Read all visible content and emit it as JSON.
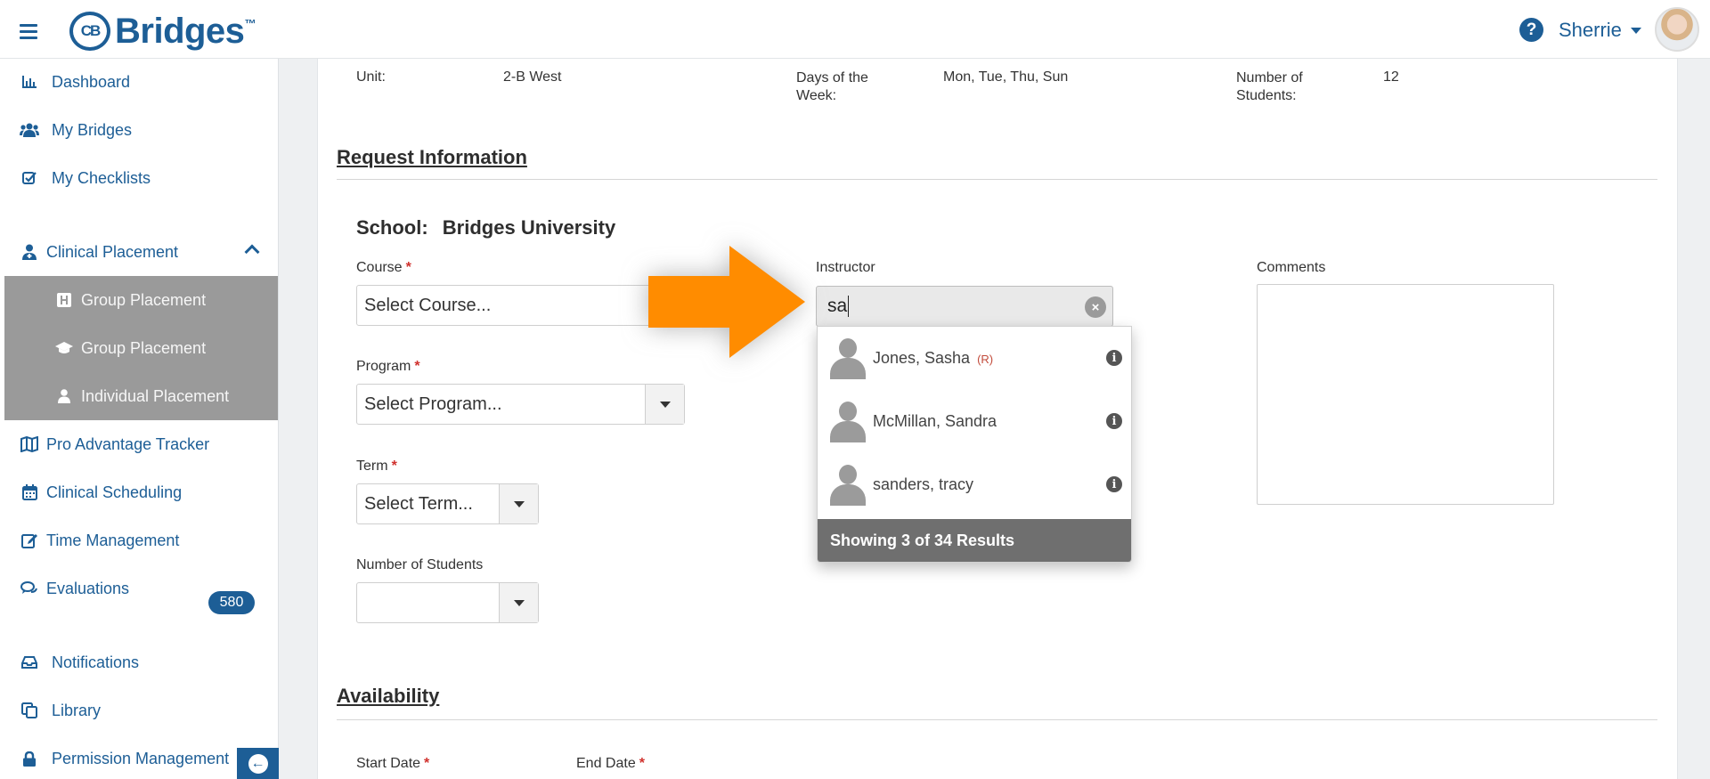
{
  "header": {
    "logo_text": "Bridges",
    "logo_badge": "CB",
    "logo_tm": "™",
    "user_name": "Sherrie"
  },
  "sidebar": {
    "items": [
      {
        "label": "Dashboard",
        "icon": "bar-chart-icon"
      },
      {
        "label": "My Bridges",
        "icon": "users-icon"
      },
      {
        "label": "My Checklists",
        "icon": "checkbox-icon"
      },
      {
        "label": "Clinical Placement",
        "icon": "user-md-icon"
      },
      {
        "label": "Pro Advantage Tracker",
        "icon": "map-icon"
      },
      {
        "label": "Clinical Scheduling",
        "icon": "calendar-icon"
      },
      {
        "label": "Time Management",
        "icon": "edit-icon"
      },
      {
        "label": "Evaluations",
        "icon": "comments-icon"
      },
      {
        "label": "Notifications",
        "icon": "inbox-icon"
      },
      {
        "label": "Library",
        "icon": "copy-icon"
      },
      {
        "label": "Permission Management",
        "icon": "lock-icon"
      }
    ],
    "sub_items": [
      {
        "label": "Group Placement",
        "icon": "h-square-icon"
      },
      {
        "label": "Group Placement",
        "icon": "graduation-cap-icon"
      },
      {
        "label": "Individual Placement",
        "icon": "user-icon"
      }
    ],
    "notifications_count": "580"
  },
  "details": {
    "unit_label": "Unit:",
    "unit_value": "2-B West",
    "days_label_1": "Days of the",
    "days_label_2": "Week:",
    "days_value": "Mon, Tue, Thu, Sun",
    "students_label_1": "Number of",
    "students_label_2": "Students:",
    "students_value": "12"
  },
  "request": {
    "section_title": "Request Information",
    "school_label": "School:",
    "school_value": "Bridges University",
    "course_label": "Course",
    "course_placeholder": "Select Course...",
    "program_label": "Program",
    "program_placeholder": "Select Program...",
    "term_label": "Term",
    "term_placeholder": "Select Term...",
    "num_students_label": "Number of Students",
    "num_students_value": "",
    "instructor_label": "Instructor",
    "instructor_value": "sa",
    "comments_label": "Comments",
    "required_mark": "*"
  },
  "instructor_results": {
    "items": [
      {
        "name": "Jones, Sasha",
        "tag": "(R)"
      },
      {
        "name": "McMillan, Sandra",
        "tag": ""
      },
      {
        "name": "sanders, tracy",
        "tag": ""
      }
    ],
    "footer": "Showing 3 of 34 Results"
  },
  "availability": {
    "section_title": "Availability",
    "start_date_label": "Start Date",
    "end_date_label": "End Date"
  },
  "colors": {
    "brand_blue": "#1d5e96",
    "highlight_arrow": "#ff8c00",
    "required_red": "#d0312d",
    "submenu_gray": "#9a9a9a"
  }
}
